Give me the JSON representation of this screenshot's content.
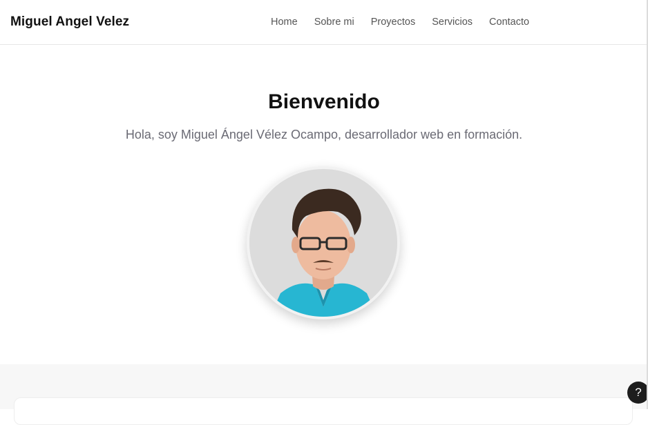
{
  "navbar": {
    "brand": "Miguel Angel Velez",
    "links": [
      {
        "label": "Home"
      },
      {
        "label": "Sobre mi"
      },
      {
        "label": "Proyectos"
      },
      {
        "label": "Servicios"
      },
      {
        "label": "Contacto"
      }
    ]
  },
  "hero": {
    "title": "Bienvenido",
    "subtitle": "Hola, soy Miguel Ángel Vélez Ocampo, desarrollador web en formación.",
    "avatar_icon": "profile-photo"
  },
  "help": {
    "label": "?",
    "icon": "question-mark-icon"
  },
  "colors": {
    "text": "#111111",
    "muted": "#6a6a74",
    "nav": "#555555",
    "section_bg": "#f7f7f7",
    "shirt": "#27b6d2"
  }
}
